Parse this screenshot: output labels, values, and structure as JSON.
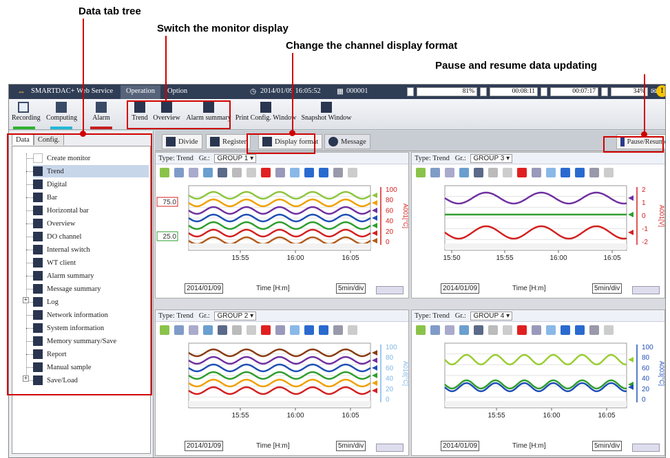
{
  "callouts": {
    "data_tab_tree": "Data tab tree",
    "switch_monitor": "Switch the monitor display",
    "change_format": "Change the channel display format",
    "pause_resume": "Pause and resume data updating"
  },
  "titlebar": {
    "app_name": "SMARTDAC+ Web Service",
    "tabs": [
      "Operation",
      "Option"
    ],
    "datetime": "2014/01/09 16:05:52",
    "id": "000001",
    "meters": [
      "81%",
      "00:08:11",
      "00:07:17",
      "34%"
    ]
  },
  "toolbar": {
    "recording": "Recording",
    "computing": "Computing",
    "alarm": "Alarm",
    "trend": "Trend",
    "overview": "Overview",
    "alarm_summary": "Alarm summary",
    "print_config": "Print Config. Window",
    "snapshot": "Snapshot Window",
    "colors": {
      "recording": "#2fb22f",
      "computing": "#22b8d6",
      "alarm": "#c81e1e"
    }
  },
  "left_tabs": [
    "Data",
    "Config."
  ],
  "tree": [
    "Create monitor",
    "Trend",
    "Digital",
    "Bar",
    "Horizontal bar",
    "Overview",
    "DO channel",
    "Internal switch",
    "WT client",
    "Alarm summary",
    "Message summary",
    "Log",
    "Network information",
    "System information",
    "Memory summary/Save",
    "Report",
    "Manual sample",
    "Save/Load"
  ],
  "mainbar": {
    "divide": "Divide",
    "register": "Register",
    "display_format": "Display format",
    "message": "Message",
    "pause_resume": "Pause/Resume"
  },
  "panels": [
    {
      "type_label": "Type: Trend",
      "gr_label": "Gr.:",
      "group": "GROUP 1",
      "ticks": [
        "15:55",
        "16:00",
        "16:05"
      ],
      "date": "2014/01/09",
      "time_label": "Time [H:m]",
      "div": "5min/div",
      "scale": [
        "100",
        "80",
        "60",
        "40",
        "20",
        "0"
      ],
      "unit": "A001[°C]",
      "markers": [
        "75.0",
        "25.0"
      ]
    },
    {
      "type_label": "Type: Trend",
      "gr_label": "Gr.:",
      "group": "GROUP 3",
      "ticks": [
        "15:50",
        "15:55",
        "16:00",
        "16:05"
      ],
      "date": "2014/01/09",
      "time_label": "Time [H:m]",
      "div": "5min/div",
      "scale": [
        "2",
        "1",
        "0",
        "-1",
        "-2"
      ],
      "unit": "A001[V]",
      "markers": []
    },
    {
      "type_label": "Type: Trend",
      "gr_label": "Gr.:",
      "group": "GROUP 2",
      "ticks": [
        "15:55",
        "16:00",
        "16:05"
      ],
      "date": "2014/01/09",
      "time_label": "Time [H:m]",
      "div": "5min/div",
      "scale": [
        "100",
        "80",
        "60",
        "40",
        "20",
        "0"
      ],
      "unit": "A018[°C]",
      "markers": []
    },
    {
      "type_label": "Type: Trend",
      "gr_label": "Gr.:",
      "group": "GROUP 4",
      "ticks": [
        "15:55",
        "16:00",
        "16:05"
      ],
      "date": "2014/01/09",
      "time_label": "Time [H:m]",
      "div": "5min/div",
      "scale": [
        "100",
        "80",
        "60",
        "40",
        "20",
        "0"
      ],
      "unit": "A003[°C]",
      "markers": []
    }
  ]
}
